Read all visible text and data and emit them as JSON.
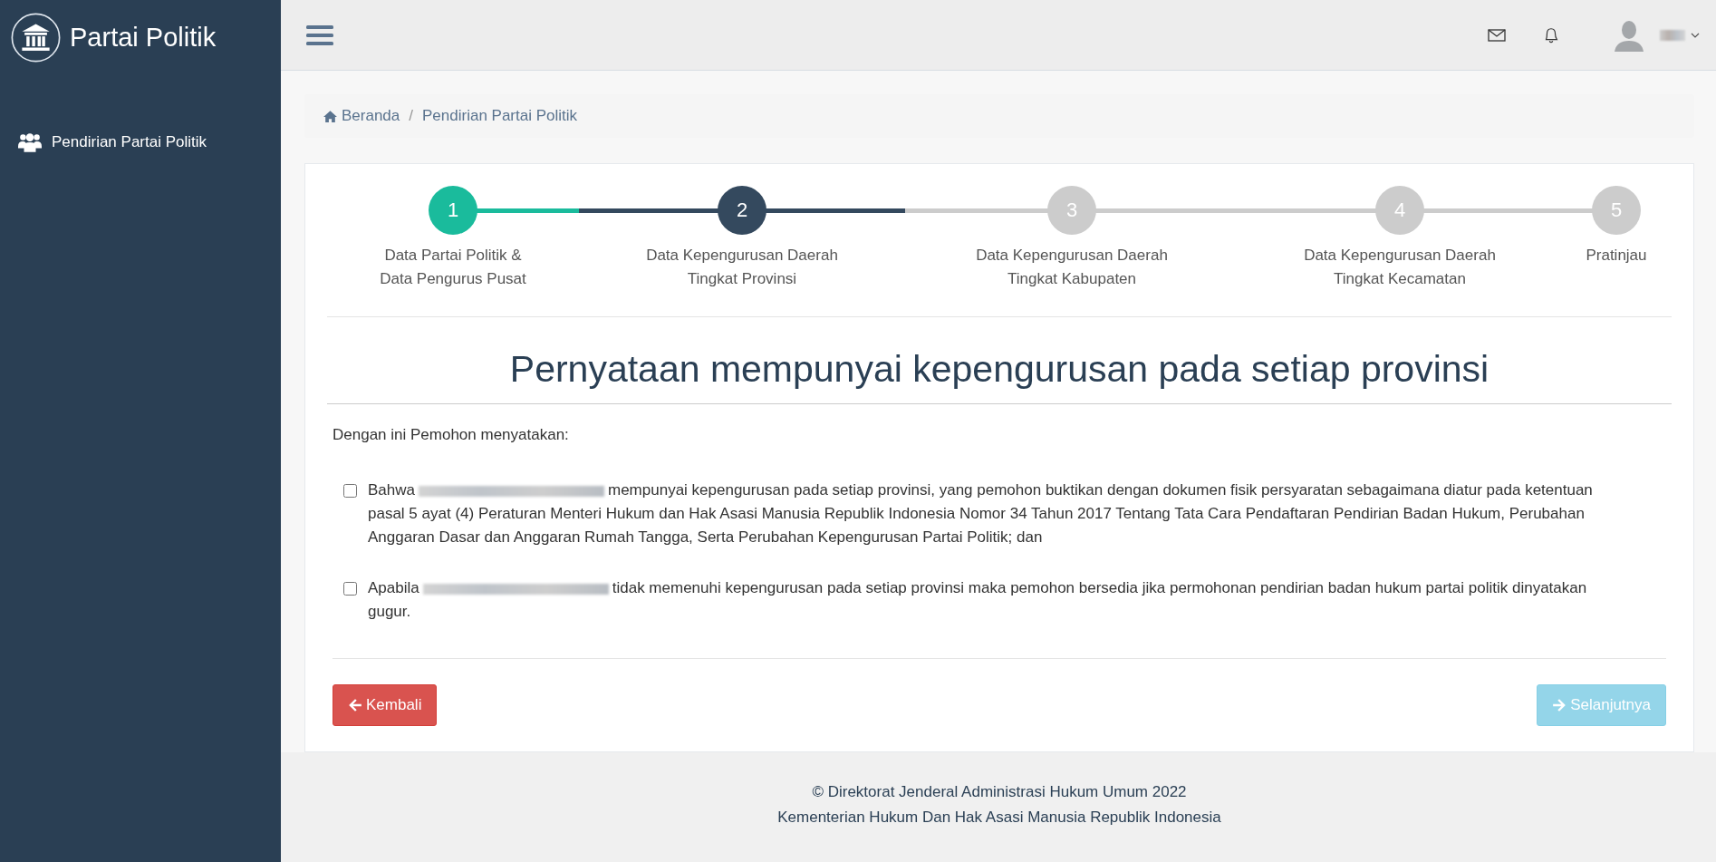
{
  "brand": {
    "title": "Partai Politik"
  },
  "sidebar": {
    "items": [
      {
        "label": "Pendirian Partai Politik"
      }
    ]
  },
  "breadcrumb": [
    {
      "label": "Beranda",
      "kind": "home"
    },
    {
      "separator": "/",
      "label": "Pendirian Partai Politik",
      "kind": "current"
    }
  ],
  "steps": [
    {
      "number": "1",
      "lines": [
        "Data Partai Politik &",
        "Data Pengurus Pusat"
      ],
      "completed": true,
      "selected": false
    },
    {
      "number": "2",
      "lines": [
        "Data Kepengurusan Daerah",
        "Tingkat Provinsi"
      ],
      "completed": false,
      "selected": true
    },
    {
      "number": "3",
      "lines": [
        "Data Kepengurusan Daerah",
        "Tingkat Kabupaten"
      ],
      "completed": false,
      "selected": false
    },
    {
      "number": "4",
      "lines": [
        "Data Kepengurusan Daerah",
        "Tingkat Kecamatan"
      ],
      "completed": false,
      "selected": false
    },
    {
      "number": "5",
      "lines": [
        "Pratinjau"
      ],
      "completed": false,
      "selected": false
    }
  ],
  "heading": "Pernyataan mempunyai kepengurusan pada setiap provinsi",
  "intro": "Dengan ini Pemohon menyatakan:",
  "statements": [
    {
      "checked": false,
      "before": "Bahwa",
      "after": "mempunyai kepengurusan pada setiap provinsi, yang pemohon buktikan dengan dokumen fisik persyaratan sebagaimana diatur pada ketentuan pasal 5 ayat (4) Peraturan Menteri Hukum dan Hak Asasi Manusia Republik Indonesia Nomor 34 Tahun 2017 Tentang Tata Cara Pendaftaran Pendirian Badan Hukum, Perubahan Anggaran Dasar dan Anggaran Rumah Tangga, Serta Perubahan Kepengurusan Partai Politik; dan"
    },
    {
      "checked": false,
      "before": "Apabila",
      "after": "tidak memenuhi kepengurusan pada setiap provinsi maka pemohon bersedia jika permohonan pendirian badan hukum partai politik dinyatakan gugur."
    }
  ],
  "buttons": [
    {
      "label": "Kembali",
      "kind": "back",
      "disabled": false
    },
    {
      "label": "Selanjutnya",
      "kind": "next",
      "disabled": true
    }
  ],
  "footer": [
    "© Direktorat Jenderal Administrasi Hukum Umum 2022",
    "Kementerian Hukum Dan Hak Asasi Manusia Republik Indonesia"
  ]
}
